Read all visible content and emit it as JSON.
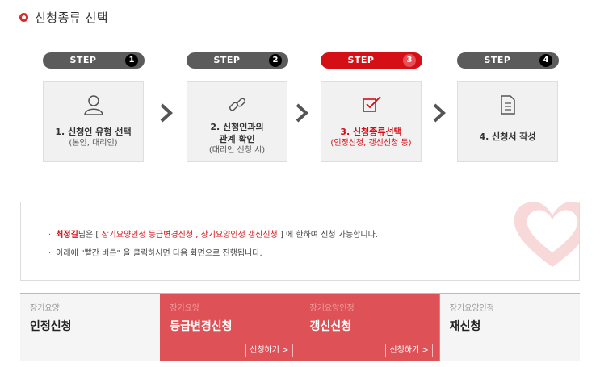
{
  "section": {
    "title": "신청종류 선택"
  },
  "steps": [
    {
      "label": "STEP",
      "num": "1",
      "text": "1. 신청인 유형 선택",
      "sub": "(본인, 대리인)",
      "icon": "person-icon",
      "active": false
    },
    {
      "label": "STEP",
      "num": "2",
      "text": "2. 신청인과의",
      "text2": "관계 확인",
      "sub": "(대리인 신청 시)",
      "icon": "link-icon",
      "active": false
    },
    {
      "label": "STEP",
      "num": "3",
      "text": "3. 신청종류선택",
      "sub": "(인정신청, 갱신신청 등)",
      "icon": "checkbox-icon",
      "active": true
    },
    {
      "label": "STEP",
      "num": "4",
      "text": "4. 신청서 작성",
      "sub": "",
      "icon": "document-icon",
      "active": false
    }
  ],
  "notice": {
    "bullet": "·",
    "name": "최정길",
    "line1_pre": "님은 [",
    "line1_items": "장기요양인정 등급변경신청 , 장기요양인정 갱신신청",
    "line1_post": "] 에 한하여 신청 가능합니다.",
    "line2": "아래에 \"빨간 버튼\" 을 클릭하시면 다음 화면으로 진행됩니다."
  },
  "tabs": [
    {
      "small": "장기요양",
      "big": "인정신청",
      "apply": "",
      "style": "gray"
    },
    {
      "small": "장기요양",
      "big": "등급변경신청",
      "apply": "신청하기 >",
      "style": "red"
    },
    {
      "small": "장기요양인정",
      "big": "갱신신청",
      "apply": "신청하기 >",
      "style": "red"
    },
    {
      "small": "장기요양인정",
      "big": "재신청",
      "apply": "",
      "style": "gray"
    }
  ],
  "colors": {
    "accent": "#d50f16",
    "tab_red": "#de5257",
    "step_gray": "#5b5b5b"
  }
}
